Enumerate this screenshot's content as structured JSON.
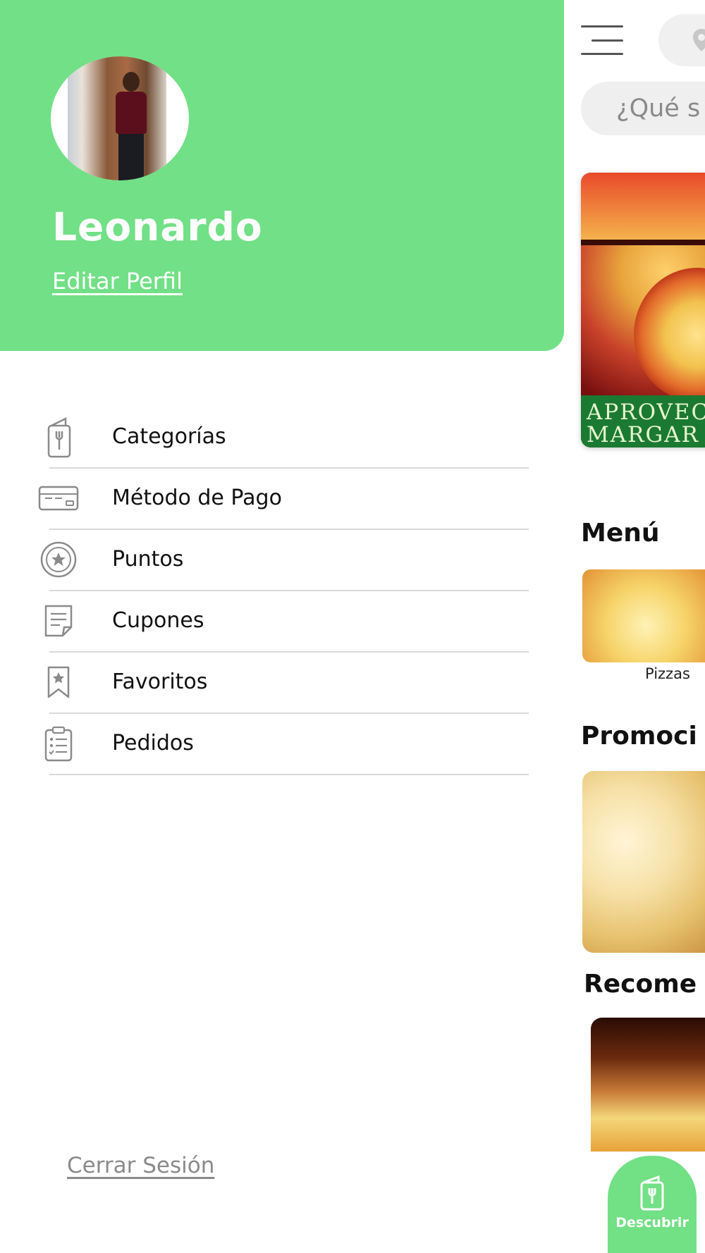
{
  "drawer": {
    "user_name": "Leonardo",
    "edit_profile": "Editar Perfil",
    "menu_items": [
      {
        "label": "Categorías",
        "icon": "food-menu-icon"
      },
      {
        "label": "Método de Pago",
        "icon": "credit-card-icon"
      },
      {
        "label": "Puntos",
        "icon": "star-badge-icon"
      },
      {
        "label": "Cupones",
        "icon": "coupon-icon"
      },
      {
        "label": "Favoritos",
        "icon": "bookmark-star-icon"
      },
      {
        "label": "Pedidos",
        "icon": "clipboard-list-icon"
      }
    ],
    "logout": "Cerrar Sesión"
  },
  "main": {
    "search_placeholder": "¿Qué s",
    "banner_text": "APROVEC\nMARGAR",
    "sections": {
      "menu_title": "Menú",
      "menu_item_label": "Pizzas",
      "promo_title": "Promoci",
      "recommended_title": "Recome"
    },
    "fab_label": "Descubrir"
  },
  "colors": {
    "accent_green": "#72e086",
    "divider": "#d9d9d9",
    "icon_gray": "#8a8a8a"
  }
}
